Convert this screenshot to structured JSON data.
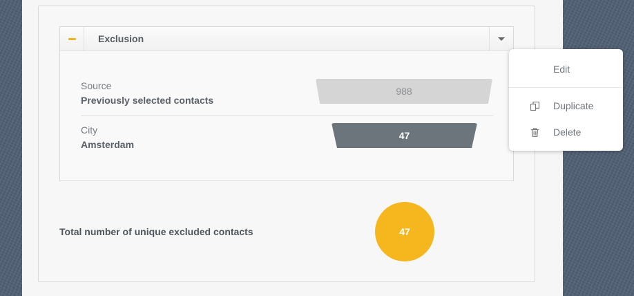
{
  "panel": {
    "title": "Exclusion",
    "rows": [
      {
        "label": "Source",
        "value": "Previously selected contacts",
        "count": "988"
      },
      {
        "label": "City",
        "value": "Amsterdam",
        "count": "47"
      }
    ]
  },
  "total": {
    "label": "Total number of unique excluded contacts",
    "count": "47"
  },
  "context_menu": {
    "items": [
      {
        "label": "Edit",
        "icon": ""
      },
      {
        "label": "Duplicate",
        "icon": "duplicate-icon"
      },
      {
        "label": "Delete",
        "icon": "trash-icon"
      }
    ]
  },
  "colors": {
    "accent": "#f5b71d",
    "source_bar": "#d5d5d5",
    "filter_bar": "#6c757c"
  }
}
